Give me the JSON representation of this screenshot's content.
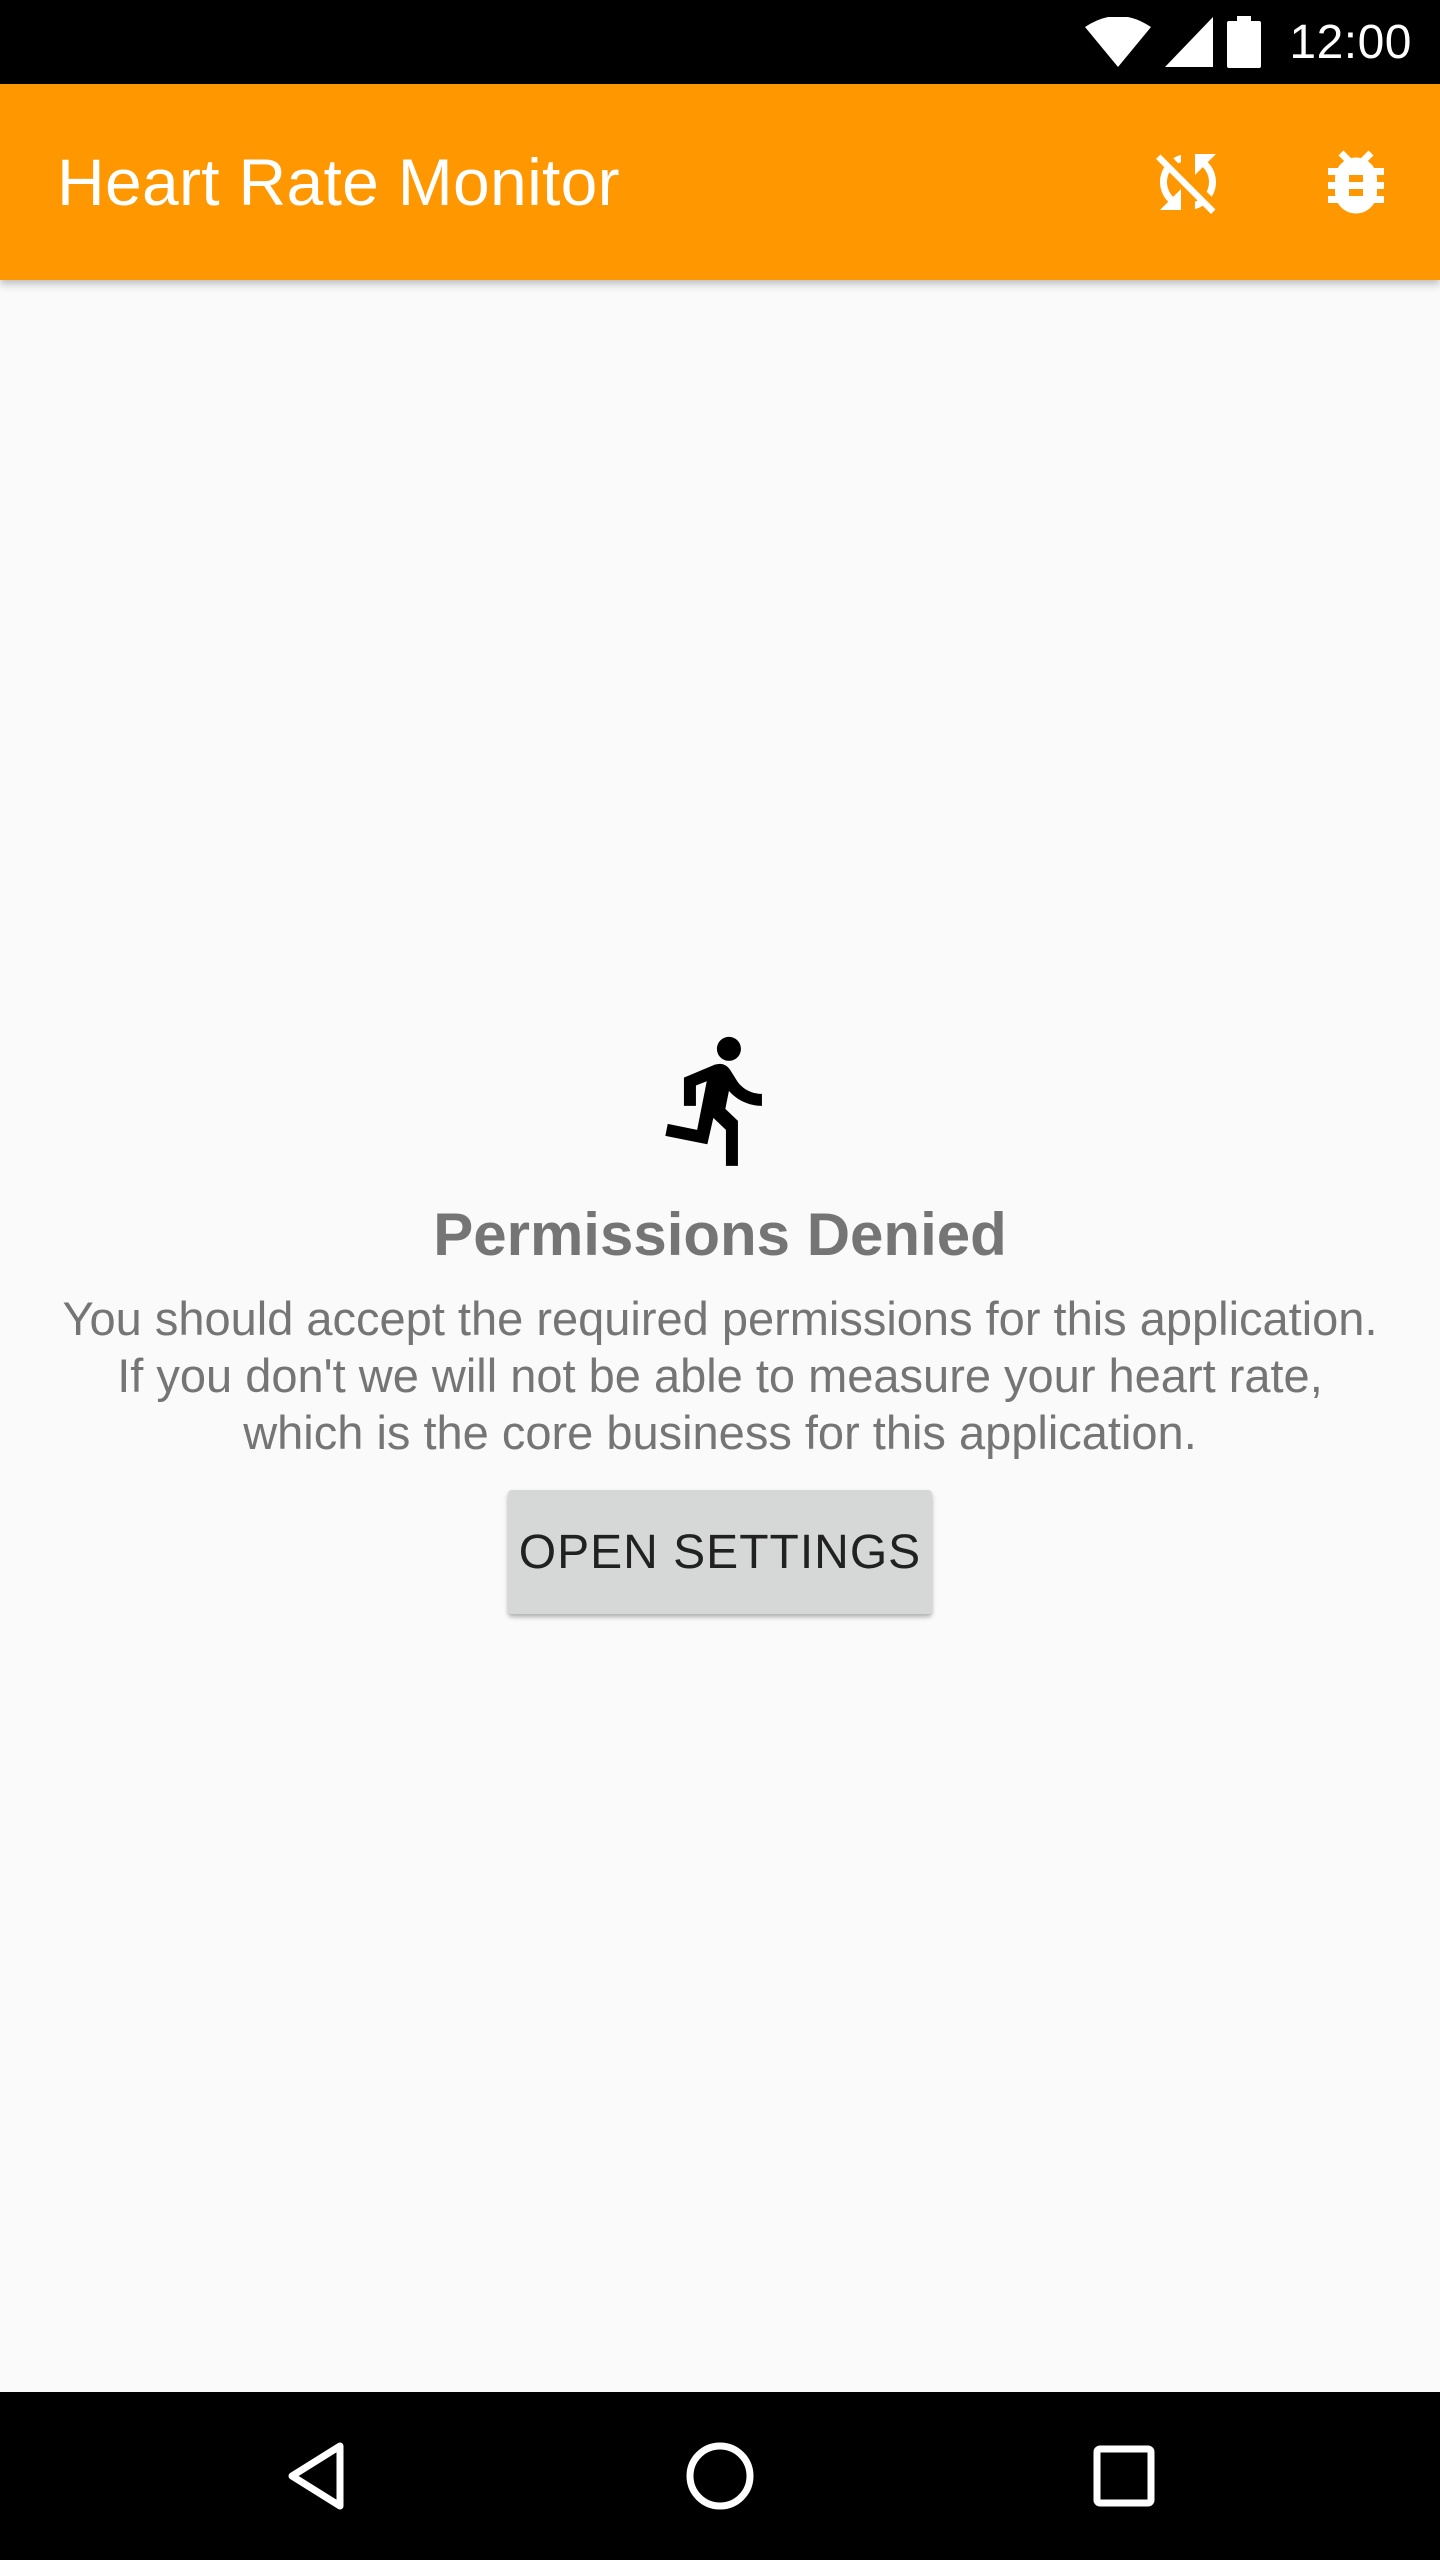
{
  "status_bar": {
    "time": "12:00",
    "icons": [
      "wifi-icon",
      "cellular-signal-icon",
      "battery-icon"
    ]
  },
  "app_bar": {
    "title": "Heart Rate Monitor",
    "background_color": "#ff9800",
    "actions": [
      {
        "name": "sync-disabled-icon"
      },
      {
        "name": "bug-report-icon"
      }
    ]
  },
  "content": {
    "icon": "running-person-icon",
    "title": "Permissions Denied",
    "message": "You should accept the required permissions for this application. If you don't we will not be able to measure your heart rate, which is the core business for this application.",
    "button_label": "OPEN SETTINGS"
  },
  "nav_bar": {
    "buttons": [
      "back-icon",
      "home-icon",
      "recents-icon"
    ]
  }
}
